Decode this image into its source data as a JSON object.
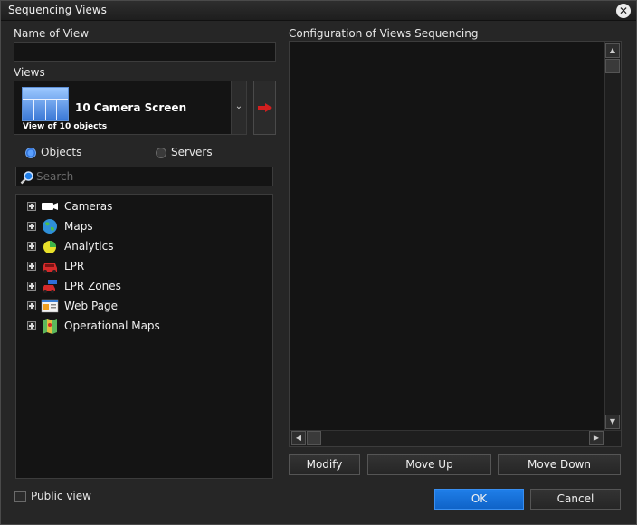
{
  "window": {
    "title": "Sequencing Views"
  },
  "name_of_view": {
    "label": "Name of View",
    "value": ""
  },
  "views": {
    "label": "Views",
    "selected_name": "10 Camera Screen",
    "selected_sub": "View of 10 objects"
  },
  "source_toggle": {
    "objects_label": "Objects",
    "servers_label": "Servers",
    "selected": "Objects"
  },
  "search": {
    "placeholder": "Search"
  },
  "tree": {
    "items": [
      {
        "label": "Cameras",
        "icon": "camera-icon"
      },
      {
        "label": "Maps",
        "icon": "globe-icon"
      },
      {
        "label": "Analytics",
        "icon": "pie-chart-icon"
      },
      {
        "label": "LPR",
        "icon": "car-icon"
      },
      {
        "label": "LPR Zones",
        "icon": "car-zone-icon"
      },
      {
        "label": "Web Page",
        "icon": "web-page-icon"
      },
      {
        "label": "Operational Maps",
        "icon": "map-icon"
      }
    ]
  },
  "config": {
    "label": "Configuration of Views Sequencing"
  },
  "buttons": {
    "modify": "Modify",
    "move_up": "Move Up",
    "move_down": "Move Down",
    "ok": "OK",
    "cancel": "Cancel"
  },
  "public_view": {
    "label": "Public view",
    "checked": false
  },
  "colors": {
    "accent": "#1a74e0",
    "background": "#262626",
    "field": "#141414"
  }
}
